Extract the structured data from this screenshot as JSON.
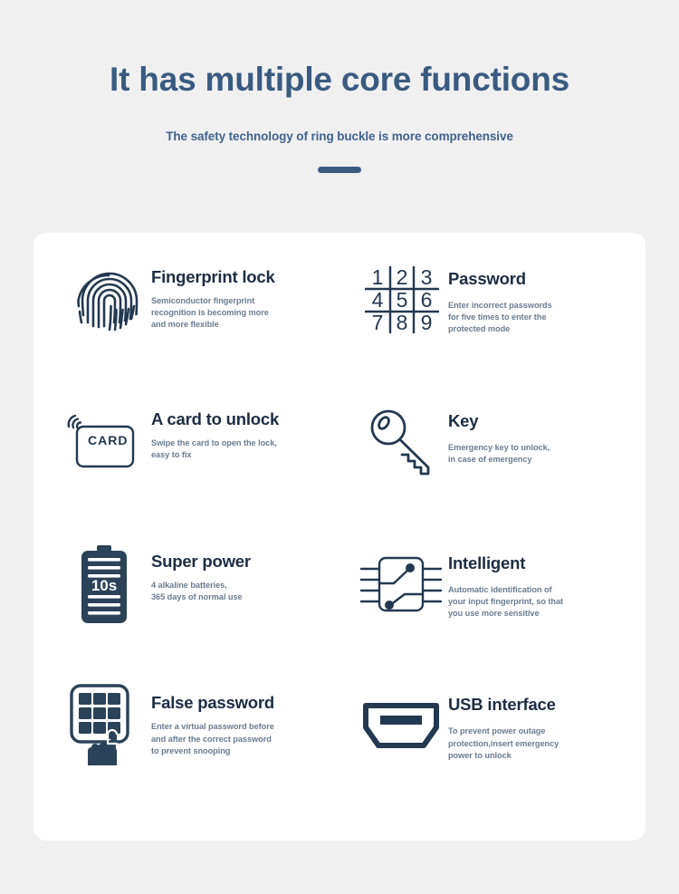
{
  "header": {
    "title": "It has multiple core functions",
    "subtitle": "The safety technology of ring buckle is more comprehensive"
  },
  "colors": {
    "background": "#f0f0f0",
    "card": "#ffffff",
    "title": "#3b5a80",
    "subtitle": "#42628a",
    "divider": "#3c5b82",
    "feature_title": "#1d2d41",
    "feature_desc": "#6a7c8e",
    "icon": "#24384f"
  },
  "features": [
    {
      "icon": "fingerprint-icon",
      "title": "Fingerprint lock",
      "desc": [
        "Semiconductor fingerprint",
        "recognition is becoming more",
        "and more flexible"
      ]
    },
    {
      "icon": "keypad-numbers-icon",
      "title": "Password",
      "desc": [
        "Enter incorrect passwords",
        "for five times to enter the",
        "protected mode"
      ],
      "keys": [
        "1",
        "2",
        "3",
        "4",
        "5",
        "6",
        "7",
        "8",
        "9"
      ]
    },
    {
      "icon": "nfc-card-icon",
      "title": "A card to unlock",
      "desc": [
        "Swipe the card to open the lock,",
        "easy to fix"
      ],
      "card_label": "CARD"
    },
    {
      "icon": "key-icon",
      "title": "Key",
      "desc": [
        "Emergency key to unlock,",
        "in case of emergency"
      ]
    },
    {
      "icon": "battery-icon",
      "title": "Super power",
      "desc": [
        "4 alkaline batteries,",
        "365 days of normal use"
      ],
      "battery_label": "10s"
    },
    {
      "icon": "chip-icon",
      "title": "Intelligent",
      "desc": [
        "Automatic identification of",
        "your input fingerprint, so that",
        "you use more sensitive"
      ]
    },
    {
      "icon": "keypad-hand-icon",
      "title": "False password",
      "desc": [
        "Enter a virtual password before",
        "and after the correct password",
        "to prevent snooping"
      ]
    },
    {
      "icon": "usb-connector-icon",
      "title": "USB interface",
      "desc": [
        "To prevent power outage",
        "protection,insert emergency",
        "power to unlock"
      ]
    }
  ]
}
